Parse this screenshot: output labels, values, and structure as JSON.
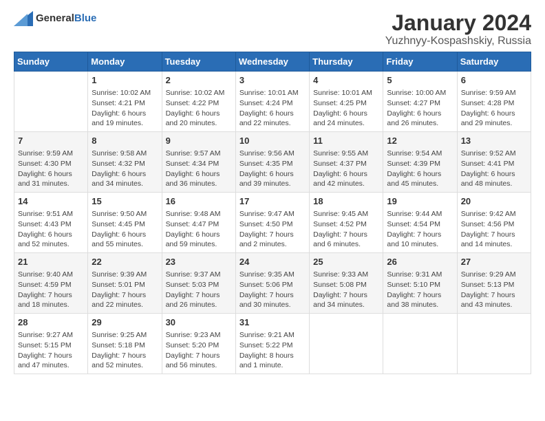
{
  "logo": {
    "text_general": "General",
    "text_blue": "Blue"
  },
  "header": {
    "title": "January 2024",
    "subtitle": "Yuzhnyy-Kospashskiy, Russia"
  },
  "weekdays": [
    "Sunday",
    "Monday",
    "Tuesday",
    "Wednesday",
    "Thursday",
    "Friday",
    "Saturday"
  ],
  "weeks": [
    [
      {
        "day": "",
        "info": ""
      },
      {
        "day": "1",
        "info": "Sunrise: 10:02 AM\nSunset: 4:21 PM\nDaylight: 6 hours\nand 19 minutes."
      },
      {
        "day": "2",
        "info": "Sunrise: 10:02 AM\nSunset: 4:22 PM\nDaylight: 6 hours\nand 20 minutes."
      },
      {
        "day": "3",
        "info": "Sunrise: 10:01 AM\nSunset: 4:24 PM\nDaylight: 6 hours\nand 22 minutes."
      },
      {
        "day": "4",
        "info": "Sunrise: 10:01 AM\nSunset: 4:25 PM\nDaylight: 6 hours\nand 24 minutes."
      },
      {
        "day": "5",
        "info": "Sunrise: 10:00 AM\nSunset: 4:27 PM\nDaylight: 6 hours\nand 26 minutes."
      },
      {
        "day": "6",
        "info": "Sunrise: 9:59 AM\nSunset: 4:28 PM\nDaylight: 6 hours\nand 29 minutes."
      }
    ],
    [
      {
        "day": "7",
        "info": "Sunrise: 9:59 AM\nSunset: 4:30 PM\nDaylight: 6 hours\nand 31 minutes."
      },
      {
        "day": "8",
        "info": "Sunrise: 9:58 AM\nSunset: 4:32 PM\nDaylight: 6 hours\nand 34 minutes."
      },
      {
        "day": "9",
        "info": "Sunrise: 9:57 AM\nSunset: 4:34 PM\nDaylight: 6 hours\nand 36 minutes."
      },
      {
        "day": "10",
        "info": "Sunrise: 9:56 AM\nSunset: 4:35 PM\nDaylight: 6 hours\nand 39 minutes."
      },
      {
        "day": "11",
        "info": "Sunrise: 9:55 AM\nSunset: 4:37 PM\nDaylight: 6 hours\nand 42 minutes."
      },
      {
        "day": "12",
        "info": "Sunrise: 9:54 AM\nSunset: 4:39 PM\nDaylight: 6 hours\nand 45 minutes."
      },
      {
        "day": "13",
        "info": "Sunrise: 9:52 AM\nSunset: 4:41 PM\nDaylight: 6 hours\nand 48 minutes."
      }
    ],
    [
      {
        "day": "14",
        "info": "Sunrise: 9:51 AM\nSunset: 4:43 PM\nDaylight: 6 hours\nand 52 minutes."
      },
      {
        "day": "15",
        "info": "Sunrise: 9:50 AM\nSunset: 4:45 PM\nDaylight: 6 hours\nand 55 minutes."
      },
      {
        "day": "16",
        "info": "Sunrise: 9:48 AM\nSunset: 4:47 PM\nDaylight: 6 hours\nand 59 minutes."
      },
      {
        "day": "17",
        "info": "Sunrise: 9:47 AM\nSunset: 4:50 PM\nDaylight: 7 hours\nand 2 minutes."
      },
      {
        "day": "18",
        "info": "Sunrise: 9:45 AM\nSunset: 4:52 PM\nDaylight: 7 hours\nand 6 minutes."
      },
      {
        "day": "19",
        "info": "Sunrise: 9:44 AM\nSunset: 4:54 PM\nDaylight: 7 hours\nand 10 minutes."
      },
      {
        "day": "20",
        "info": "Sunrise: 9:42 AM\nSunset: 4:56 PM\nDaylight: 7 hours\nand 14 minutes."
      }
    ],
    [
      {
        "day": "21",
        "info": "Sunrise: 9:40 AM\nSunset: 4:59 PM\nDaylight: 7 hours\nand 18 minutes."
      },
      {
        "day": "22",
        "info": "Sunrise: 9:39 AM\nSunset: 5:01 PM\nDaylight: 7 hours\nand 22 minutes."
      },
      {
        "day": "23",
        "info": "Sunrise: 9:37 AM\nSunset: 5:03 PM\nDaylight: 7 hours\nand 26 minutes."
      },
      {
        "day": "24",
        "info": "Sunrise: 9:35 AM\nSunset: 5:06 PM\nDaylight: 7 hours\nand 30 minutes."
      },
      {
        "day": "25",
        "info": "Sunrise: 9:33 AM\nSunset: 5:08 PM\nDaylight: 7 hours\nand 34 minutes."
      },
      {
        "day": "26",
        "info": "Sunrise: 9:31 AM\nSunset: 5:10 PM\nDaylight: 7 hours\nand 38 minutes."
      },
      {
        "day": "27",
        "info": "Sunrise: 9:29 AM\nSunset: 5:13 PM\nDaylight: 7 hours\nand 43 minutes."
      }
    ],
    [
      {
        "day": "28",
        "info": "Sunrise: 9:27 AM\nSunset: 5:15 PM\nDaylight: 7 hours\nand 47 minutes."
      },
      {
        "day": "29",
        "info": "Sunrise: 9:25 AM\nSunset: 5:18 PM\nDaylight: 7 hours\nand 52 minutes."
      },
      {
        "day": "30",
        "info": "Sunrise: 9:23 AM\nSunset: 5:20 PM\nDaylight: 7 hours\nand 56 minutes."
      },
      {
        "day": "31",
        "info": "Sunrise: 9:21 AM\nSunset: 5:22 PM\nDaylight: 8 hours\nand 1 minute."
      },
      {
        "day": "",
        "info": ""
      },
      {
        "day": "",
        "info": ""
      },
      {
        "day": "",
        "info": ""
      }
    ]
  ]
}
